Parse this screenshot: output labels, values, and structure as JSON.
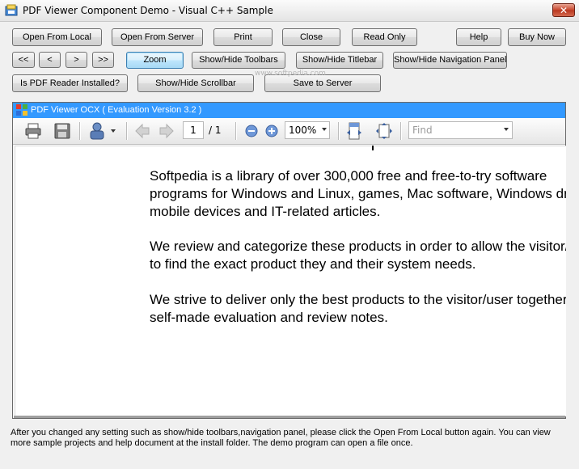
{
  "window": {
    "title": "PDF Viewer Component Demo - Visual C++ Sample",
    "close_glyph": "✕"
  },
  "buttons": {
    "open_local": "Open From Local",
    "open_server": "Open From Server",
    "print": "Print",
    "close": "Close",
    "read_only": "Read Only",
    "help": "Help",
    "buy_now": "Buy Now",
    "first": "<<",
    "prev": "<",
    "next": ">",
    "last": ">>",
    "zoom": "Zoom",
    "toggle_toolbars": "Show/Hide Toolbars",
    "toggle_titlebar": "Show/Hide Titlebar",
    "toggle_nav": "Show/Hide Navigation Panel",
    "is_reader": "Is PDF Reader Installed?",
    "toggle_scrollbar": "Show/Hide Scrollbar",
    "save_server": "Save to Server"
  },
  "viewer": {
    "title": "PDF Viewer OCX ( Evaluation Version 3.2 )",
    "current_page": "1",
    "page_total": "/ 1",
    "zoom": "100%",
    "find_placeholder": "Find"
  },
  "document": {
    "paragraphs": [
      [
        "Softpedia is a library of over 300,000 free and free-to-try software",
        "programs for Windows and Linux, games, Mac software, Windows drivers,",
        "mobile devices and IT-related articles."
      ],
      [
        "We review and categorize these products in order to allow the visitor/user",
        "to find the exact product they and their system needs."
      ],
      [
        "We strive to deliver only the best products to the visitor/user together with",
        "self-made evaluation and review notes."
      ]
    ]
  },
  "footer_note": "After you changed any setting such as show/hide toolbars,navigation panel, please click the Open From Local button again. You can view more sample projects and help document at the install folder. The demo program can open a file once.",
  "watermark": "www.softpedia.com",
  "colors": {
    "accent": "#3399ff",
    "close_button": "#c7452c"
  }
}
